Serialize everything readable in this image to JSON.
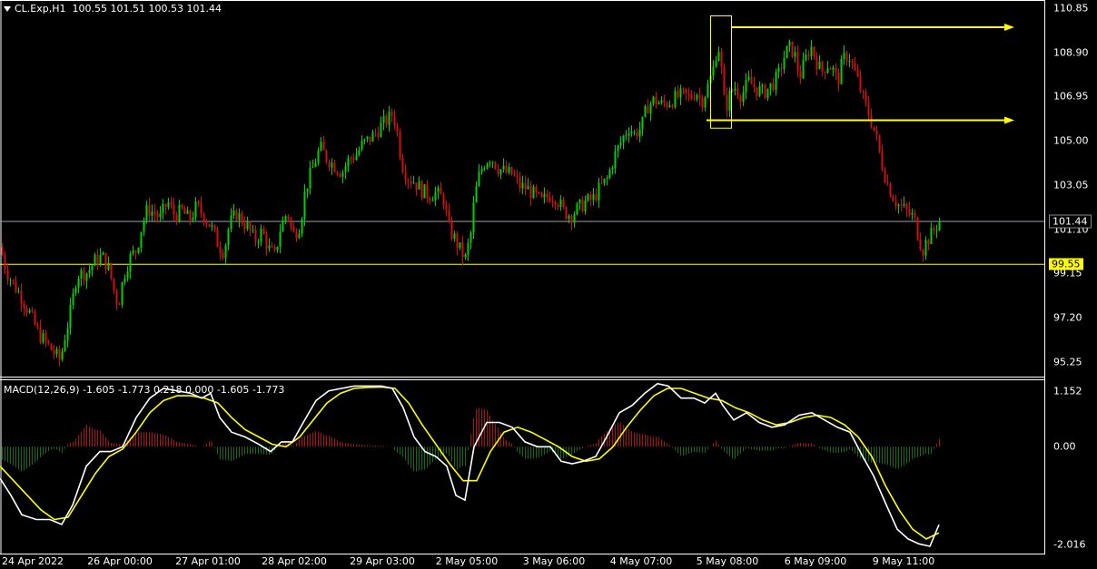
{
  "header": {
    "symbol": "CL.Exp,H1",
    "ohlc": "100.55 101.51 100.53 101.44"
  },
  "macd": {
    "label": "MACD(12,26,9) -1.605 -1.773 0.218 0.000 -1.605 -1.773"
  },
  "price_axis": {
    "ticks": [
      "110.85",
      "108.90",
      "106.95",
      "105.00",
      "103.05",
      "101.10",
      "99.15",
      "97.20",
      "95.25"
    ]
  },
  "macd_axis": {
    "ticks": [
      "1.152",
      "0.00",
      "-2.016"
    ]
  },
  "current_price": "101.44",
  "level_price": "99.55",
  "time_axis": {
    "labels": [
      "24 Apr 2022",
      "26 Apr 00:00",
      "27 Apr 01:00",
      "28 Apr 02:00",
      "29 Apr 03:00",
      "2 May 05:00",
      "3 May 06:00",
      "4 May 07:00",
      "5 May 08:00",
      "6 May 09:00",
      "9 May 11:00"
    ]
  },
  "colors": {
    "bull": "#00d000",
    "bear": "#d01010",
    "hist_pos": "#b01010",
    "hist_neg": "#107010",
    "macd_line": "#ffffff",
    "signal_line": "#ffff00",
    "level_line": "#ffff00",
    "price_line": "#9aa0b0",
    "annotation": "#ffff00"
  },
  "chart_data": {
    "type": "candlestick",
    "timeframe": "H1",
    "y_range": [
      94.6,
      111.2
    ],
    "price_ticks": [
      110.85,
      108.9,
      106.95,
      105.0,
      103.05,
      101.1,
      99.15,
      97.2,
      95.25
    ],
    "current_price": 101.44,
    "horizontal_level": 99.55,
    "price_path": [
      [
        0,
        100.3
      ],
      [
        6,
        99.3
      ],
      [
        14,
        98.7
      ],
      [
        22,
        98.2
      ],
      [
        32,
        97.4
      ],
      [
        42,
        96.5
      ],
      [
        52,
        96.0
      ],
      [
        60,
        95.6
      ],
      [
        66,
        95.3
      ],
      [
        70,
        96.2
      ],
      [
        78,
        97.6
      ],
      [
        84,
        99.1
      ],
      [
        96,
        99.2
      ],
      [
        104,
        99.7
      ],
      [
        112,
        99.9
      ],
      [
        120,
        99.3
      ],
      [
        126,
        98.2
      ],
      [
        130,
        97.8
      ],
      [
        136,
        99.1
      ],
      [
        142,
        99.8
      ],
      [
        150,
        100.2
      ],
      [
        156,
        101.3
      ],
      [
        162,
        102.0
      ],
      [
        170,
        101.8
      ],
      [
        176,
        101.6
      ],
      [
        184,
        102.3
      ],
      [
        192,
        101.7
      ],
      [
        200,
        101.9
      ],
      [
        208,
        101.5
      ],
      [
        216,
        102.1
      ],
      [
        224,
        101.7
      ],
      [
        232,
        101.2
      ],
      [
        240,
        100.4
      ],
      [
        246,
        100.1
      ],
      [
        252,
        101.3
      ],
      [
        260,
        101.8
      ],
      [
        266,
        101.5
      ],
      [
        272,
        101.2
      ],
      [
        280,
        100.6
      ],
      [
        288,
        101.0
      ],
      [
        296,
        100.2
      ],
      [
        302,
        99.9
      ],
      [
        308,
        101.1
      ],
      [
        316,
        101.9
      ],
      [
        322,
        100.8
      ],
      [
        330,
        101.3
      ],
      [
        336,
        102.9
      ],
      [
        344,
        103.8
      ],
      [
        352,
        104.7
      ],
      [
        360,
        104.2
      ],
      [
        368,
        103.9
      ],
      [
        376,
        103.6
      ],
      [
        384,
        104.2
      ],
      [
        392,
        104.4
      ],
      [
        398,
        104.8
      ],
      [
        404,
        105.0
      ],
      [
        412,
        105.3
      ],
      [
        420,
        105.7
      ],
      [
        428,
        106.0
      ],
      [
        432,
        106.2
      ],
      [
        436,
        105.6
      ],
      [
        442,
        104.0
      ],
      [
        448,
        103.4
      ],
      [
        456,
        103.2
      ],
      [
        464,
        102.8
      ],
      [
        472,
        102.6
      ],
      [
        480,
        102.7
      ],
      [
        488,
        102.4
      ],
      [
        494,
        101.1
      ],
      [
        500,
        100.7
      ],
      [
        506,
        100.2
      ],
      [
        512,
        99.8
      ],
      [
        518,
        100.9
      ],
      [
        522,
        102.5
      ],
      [
        528,
        103.6
      ],
      [
        534,
        104.1
      ],
      [
        540,
        104.3
      ],
      [
        548,
        103.8
      ],
      [
        556,
        103.6
      ],
      [
        564,
        103.5
      ],
      [
        572,
        103.0
      ],
      [
        580,
        102.9
      ],
      [
        588,
        102.6
      ],
      [
        596,
        102.3
      ],
      [
        604,
        102.6
      ],
      [
        612,
        102.5
      ],
      [
        620,
        101.9
      ],
      [
        628,
        101.7
      ],
      [
        636,
        102.0
      ],
      [
        644,
        102.3
      ],
      [
        652,
        102.4
      ],
      [
        660,
        102.9
      ],
      [
        668,
        103.3
      ],
      [
        676,
        104.3
      ],
      [
        684,
        105.0
      ],
      [
        692,
        105.6
      ],
      [
        698,
        105.3
      ],
      [
        706,
        105.6
      ],
      [
        712,
        106.5
      ],
      [
        720,
        106.8
      ],
      [
        728,
        106.6
      ],
      [
        736,
        106.7
      ],
      [
        744,
        106.9
      ],
      [
        752,
        107.0
      ],
      [
        760,
        106.9
      ],
      [
        766,
        107.2
      ],
      [
        772,
        106.7
      ],
      [
        780,
        107.5
      ],
      [
        786,
        108.3
      ],
      [
        790,
        109.4
      ],
      [
        794,
        108.1
      ],
      [
        798,
        106.3
      ],
      [
        802,
        106.9
      ],
      [
        808,
        107.4
      ],
      [
        816,
        107.0
      ],
      [
        824,
        107.6
      ],
      [
        832,
        107.3
      ],
      [
        840,
        107.1
      ],
      [
        848,
        107.4
      ],
      [
        856,
        107.8
      ],
      [
        862,
        108.6
      ],
      [
        868,
        109.1
      ],
      [
        874,
        108.9
      ],
      [
        880,
        107.8
      ],
      [
        886,
        108.5
      ],
      [
        892,
        109.2
      ],
      [
        898,
        108.6
      ],
      [
        904,
        108.0
      ],
      [
        910,
        108.4
      ],
      [
        916,
        108.2
      ],
      [
        922,
        107.6
      ],
      [
        928,
        108.6
      ],
      [
        934,
        108.8
      ],
      [
        940,
        108.1
      ],
      [
        946,
        107.4
      ],
      [
        952,
        106.6
      ],
      [
        958,
        106.0
      ],
      [
        964,
        105.2
      ],
      [
        970,
        104.1
      ],
      [
        976,
        103.2
      ],
      [
        982,
        102.6
      ],
      [
        988,
        102.2
      ],
      [
        994,
        102.0
      ],
      [
        1000,
        101.8
      ],
      [
        1006,
        101.6
      ],
      [
        1012,
        100.6
      ],
      [
        1016,
        100.2
      ],
      [
        1020,
        100.6
      ],
      [
        1026,
        100.9
      ],
      [
        1030,
        101.2
      ],
      [
        1034,
        101.44
      ]
    ],
    "macd_range": [
      -2.2,
      1.35
    ],
    "macd_ticks": [
      1.152,
      0.0,
      -2.016
    ],
    "macd_path": [
      [
        0,
        -0.65
      ],
      [
        12,
        -1.0
      ],
      [
        24,
        -1.4
      ],
      [
        40,
        -1.5
      ],
      [
        55,
        -1.5
      ],
      [
        68,
        -1.6
      ],
      [
        80,
        -1.2
      ],
      [
        95,
        -0.4
      ],
      [
        110,
        -0.1
      ],
      [
        122,
        -0.1
      ],
      [
        135,
        0.0
      ],
      [
        150,
        0.6
      ],
      [
        165,
        1.0
      ],
      [
        180,
        1.2
      ],
      [
        195,
        1.15
      ],
      [
        210,
        1.1
      ],
      [
        222,
        1.0
      ],
      [
        232,
        1.1
      ],
      [
        242,
        0.6
      ],
      [
        255,
        0.3
      ],
      [
        270,
        0.2
      ],
      [
        285,
        0.05
      ],
      [
        298,
        -0.1
      ],
      [
        310,
        0.1
      ],
      [
        322,
        0.1
      ],
      [
        334,
        0.5
      ],
      [
        348,
        0.95
      ],
      [
        362,
        1.15
      ],
      [
        376,
        1.2
      ],
      [
        390,
        1.25
      ],
      [
        405,
        1.25
      ],
      [
        420,
        1.25
      ],
      [
        432,
        1.2
      ],
      [
        444,
        0.8
      ],
      [
        456,
        0.2
      ],
      [
        468,
        -0.1
      ],
      [
        480,
        -0.2
      ],
      [
        492,
        -0.4
      ],
      [
        502,
        -1.0
      ],
      [
        512,
        -1.1
      ],
      [
        522,
        0.0
      ],
      [
        536,
        0.5
      ],
      [
        550,
        0.5
      ],
      [
        564,
        0.4
      ],
      [
        578,
        0.1
      ],
      [
        592,
        0.0
      ],
      [
        606,
        0.0
      ],
      [
        618,
        -0.3
      ],
      [
        630,
        -0.35
      ],
      [
        642,
        -0.3
      ],
      [
        656,
        -0.2
      ],
      [
        668,
        0.2
      ],
      [
        682,
        0.7
      ],
      [
        696,
        0.85
      ],
      [
        710,
        1.1
      ],
      [
        724,
        1.3
      ],
      [
        736,
        1.25
      ],
      [
        750,
        1.0
      ],
      [
        764,
        1.0
      ],
      [
        776,
        0.9
      ],
      [
        788,
        1.1
      ],
      [
        796,
        0.85
      ],
      [
        808,
        0.55
      ],
      [
        822,
        0.7
      ],
      [
        836,
        0.5
      ],
      [
        850,
        0.4
      ],
      [
        864,
        0.45
      ],
      [
        880,
        0.65
      ],
      [
        894,
        0.7
      ],
      [
        908,
        0.55
      ],
      [
        922,
        0.4
      ],
      [
        936,
        0.3
      ],
      [
        950,
        -0.2
      ],
      [
        962,
        -0.6
      ],
      [
        976,
        -1.2
      ],
      [
        988,
        -1.7
      ],
      [
        1000,
        -1.9
      ],
      [
        1012,
        -2.0
      ],
      [
        1024,
        -2.05
      ],
      [
        1034,
        -1.605
      ]
    ],
    "signal_path": [
      [
        0,
        -0.4
      ],
      [
        15,
        -0.7
      ],
      [
        30,
        -1.0
      ],
      [
        45,
        -1.3
      ],
      [
        60,
        -1.5
      ],
      [
        75,
        -1.45
      ],
      [
        90,
        -1.0
      ],
      [
        105,
        -0.55
      ],
      [
        120,
        -0.2
      ],
      [
        135,
        -0.05
      ],
      [
        150,
        0.3
      ],
      [
        165,
        0.7
      ],
      [
        180,
        0.95
      ],
      [
        195,
        1.05
      ],
      [
        210,
        1.05
      ],
      [
        225,
        1.0
      ],
      [
        240,
        0.9
      ],
      [
        255,
        0.6
      ],
      [
        270,
        0.35
      ],
      [
        285,
        0.2
      ],
      [
        300,
        0.05
      ],
      [
        315,
        0.0
      ],
      [
        330,
        0.2
      ],
      [
        345,
        0.55
      ],
      [
        360,
        0.9
      ],
      [
        375,
        1.1
      ],
      [
        390,
        1.2
      ],
      [
        405,
        1.22
      ],
      [
        420,
        1.23
      ],
      [
        435,
        1.2
      ],
      [
        450,
        0.9
      ],
      [
        465,
        0.45
      ],
      [
        480,
        0.05
      ],
      [
        495,
        -0.35
      ],
      [
        510,
        -0.7
      ],
      [
        525,
        -0.7
      ],
      [
        540,
        -0.1
      ],
      [
        555,
        0.3
      ],
      [
        570,
        0.4
      ],
      [
        585,
        0.3
      ],
      [
        600,
        0.15
      ],
      [
        615,
        0.0
      ],
      [
        630,
        -0.2
      ],
      [
        645,
        -0.3
      ],
      [
        660,
        -0.25
      ],
      [
        675,
        0.0
      ],
      [
        690,
        0.4
      ],
      [
        705,
        0.75
      ],
      [
        720,
        1.05
      ],
      [
        735,
        1.2
      ],
      [
        750,
        1.2
      ],
      [
        765,
        1.1
      ],
      [
        780,
        1.0
      ],
      [
        795,
        0.95
      ],
      [
        810,
        0.8
      ],
      [
        825,
        0.7
      ],
      [
        840,
        0.55
      ],
      [
        855,
        0.45
      ],
      [
        870,
        0.5
      ],
      [
        885,
        0.6
      ],
      [
        900,
        0.65
      ],
      [
        915,
        0.6
      ],
      [
        930,
        0.45
      ],
      [
        945,
        0.2
      ],
      [
        960,
        -0.2
      ],
      [
        975,
        -0.8
      ],
      [
        990,
        -1.3
      ],
      [
        1005,
        -1.7
      ],
      [
        1020,
        -1.9
      ],
      [
        1034,
        -1.773
      ]
    ]
  }
}
